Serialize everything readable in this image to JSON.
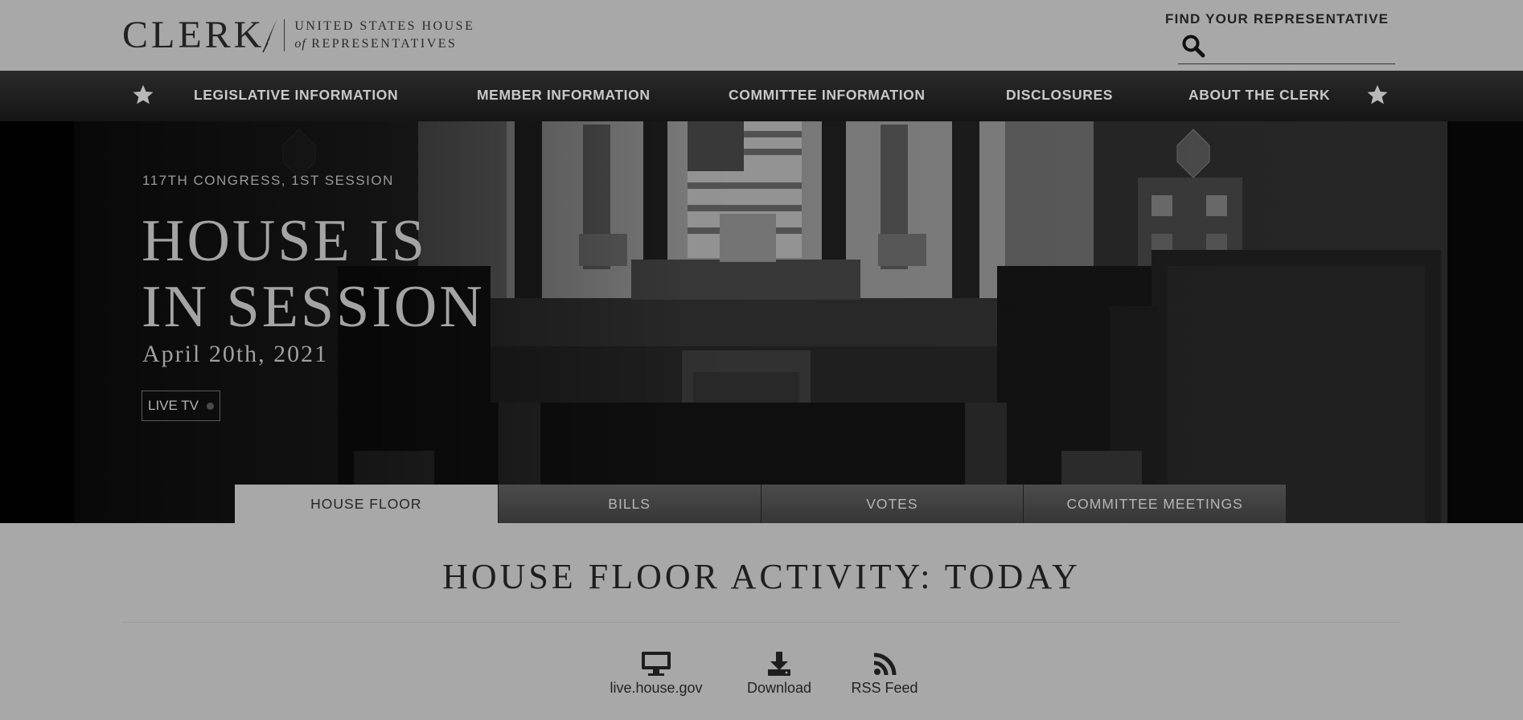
{
  "header": {
    "logo_main": "CLERK",
    "logo_line1": "UNITED STATES HOUSE",
    "logo_of": "of",
    "logo_line2": "REPRESENTATIVES",
    "find_rep_label": "FIND YOUR REPRESENTATIVE",
    "search_value": ""
  },
  "nav": {
    "items": [
      {
        "label": "LEGISLATIVE INFORMATION"
      },
      {
        "label": "MEMBER INFORMATION"
      },
      {
        "label": "COMMITTEE INFORMATION"
      },
      {
        "label": "DISCLOSURES"
      },
      {
        "label": "ABOUT THE CLERK"
      }
    ]
  },
  "hero": {
    "session_label": "117TH CONGRESS, 1ST SESSION",
    "title_line1": "HOUSE IS",
    "title_line2": "IN SESSION",
    "date": "April 20th, 2021",
    "live_tv": "LIVE TV"
  },
  "tabs": [
    {
      "label": "HOUSE FLOOR",
      "active": true
    },
    {
      "label": "BILLS",
      "active": false
    },
    {
      "label": "VOTES",
      "active": false
    },
    {
      "label": "COMMITTEE MEETINGS",
      "active": false
    }
  ],
  "content": {
    "title": "HOUSE FLOOR ACTIVITY: TODAY",
    "links": [
      {
        "label": "live.house.gov",
        "icon": "monitor-icon"
      },
      {
        "label": "Download",
        "icon": "download-icon"
      },
      {
        "label": "RSS Feed",
        "icon": "rss-icon"
      }
    ]
  },
  "colors": {
    "page_bg": "#a8a8a8",
    "nav_bg": "#1f1f1f",
    "text_dark": "#222222"
  }
}
